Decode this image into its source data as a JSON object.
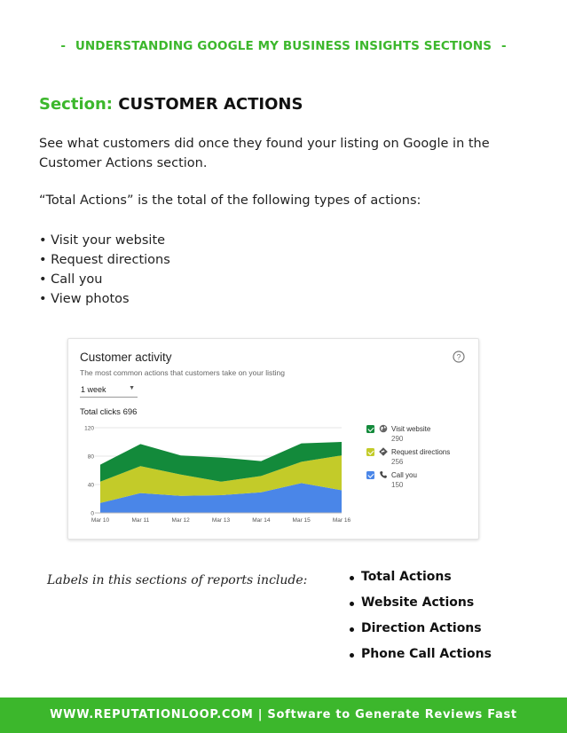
{
  "header": {
    "dash_left": "-",
    "title": "UNDERSTANDING GOOGLE MY BUSINESS INSIGHTS SECTIONS",
    "dash_right": "-"
  },
  "section": {
    "label": "Section:",
    "name": "CUSTOMER ACTIONS"
  },
  "body": {
    "paragraph1": "See what customers did once they found your listing on Google in the Customer Actions section.",
    "paragraph2": "“Total Actions” is the total of the following types of actions:",
    "bullets": [
      "• Visit your website",
      "• Request directions",
      "• Call you",
      "• View photos"
    ]
  },
  "card": {
    "title": "Customer activity",
    "subtitle": "The most common actions that customers take on your listing",
    "dropdown_value": "1 week",
    "total_clicks": "Total clicks 696",
    "help_icon": "help-circle-icon"
  },
  "chart_data": {
    "type": "area",
    "stacked": true,
    "x": [
      "Mar 10",
      "Mar 11",
      "Mar 12",
      "Mar 13",
      "Mar 14",
      "Mar 15",
      "Mar 16"
    ],
    "y_ticks": [
      "0",
      "40",
      "80",
      "120"
    ],
    "ylim": [
      0,
      120
    ],
    "series": [
      {
        "name": "Call you",
        "total": "150",
        "color": "#4a86e8",
        "values": [
          14,
          28,
          24,
          25,
          29,
          42,
          32
        ]
      },
      {
        "name": "Request directions",
        "total": "256",
        "color": "#c3cb29",
        "values": [
          30,
          38,
          30,
          19,
          23,
          30,
          49
        ]
      },
      {
        "name": "Visit website",
        "total": "290",
        "color": "#138a3b",
        "values": [
          24,
          31,
          27,
          34,
          21,
          26,
          19
        ]
      }
    ],
    "legend_position": "right",
    "grid": true
  },
  "notes": {
    "labels_intro": "Labels in this sections of reports include:",
    "labels": [
      "Total Actions",
      "Website Actions",
      "Direction Actions",
      "Phone Call Actions"
    ]
  },
  "footer": {
    "text": "WWW.REPUTATIONLOOP.COM  |  Software to Generate Reviews Fast"
  }
}
